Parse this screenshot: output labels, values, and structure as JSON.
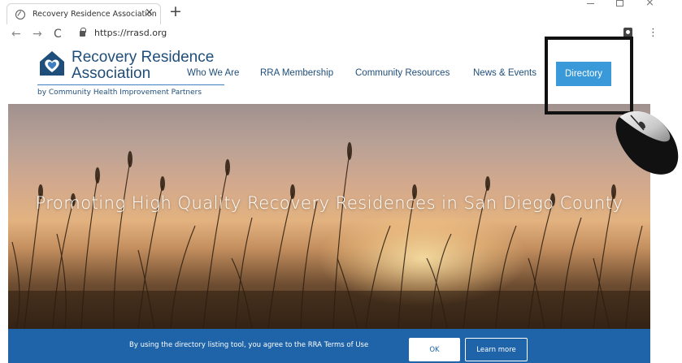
{
  "browser": {
    "tab_title": "Recovery Residence Association",
    "tab_close": "×",
    "new_tab": "+",
    "url": "https://rrasd.org",
    "back": "←",
    "forward": "→",
    "reload": "C",
    "menu": "⋮",
    "window_close": "×"
  },
  "logo": {
    "line1": "Recovery Residence",
    "line2": "Association",
    "tagline": "by Community Health Improvement Partners",
    "brand_color": "#1f4e7a",
    "accent_color": "#3d7fc0"
  },
  "nav": {
    "items": [
      {
        "label": "Who We Are"
      },
      {
        "label": "RRA Membership"
      },
      {
        "label": "Community Resources"
      },
      {
        "label": "News & Events"
      }
    ],
    "directory_label": "Directory",
    "directory_color": "#3a9ad9"
  },
  "hero": {
    "title": "Promoting High Quality Recovery Residences in San Diego County"
  },
  "cookie_bar": {
    "message": "By using the directory listing tool, you agree to the RRA Terms of Use",
    "ok_label": "OK",
    "learn_more_label": "Learn more",
    "background": "#1f64a8"
  },
  "icons": [
    "chrome-favicon-icon",
    "lock-icon",
    "extension-icon",
    "menu-icon",
    "logo-house-heart-icon",
    "computer-mouse-icon"
  ]
}
